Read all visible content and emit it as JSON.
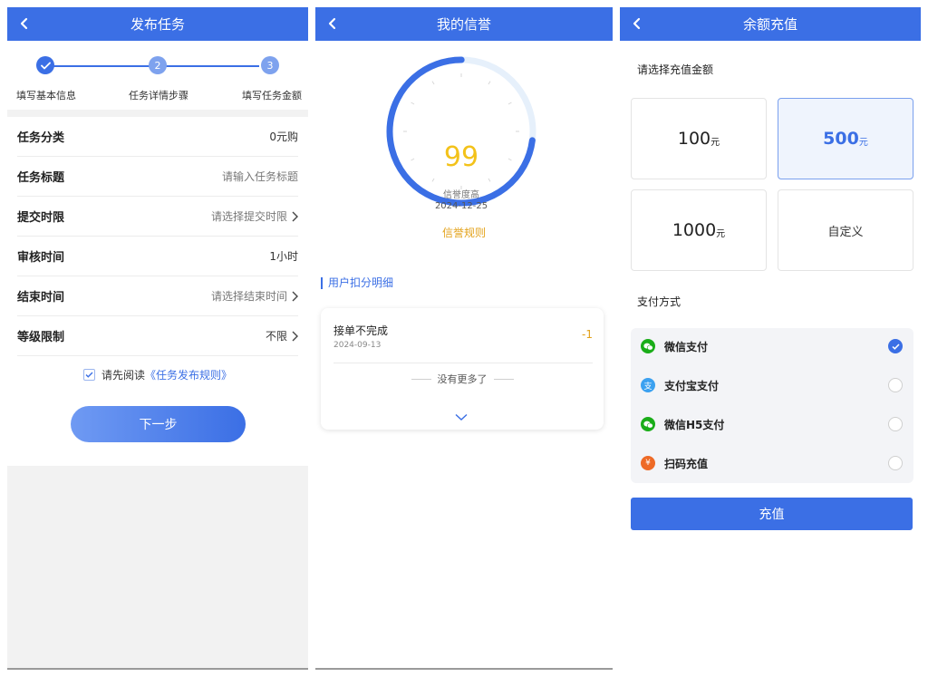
{
  "publish": {
    "title": "发布任务",
    "steps": [
      {
        "num": "",
        "label": "填写基本信息",
        "done": true
      },
      {
        "num": "2",
        "label": "任务详情步骤",
        "done": false
      },
      {
        "num": "3",
        "label": "填写任务金额",
        "done": false
      }
    ],
    "rows": [
      {
        "label": "任务分类",
        "value": "0元购",
        "placeholder": false,
        "chevron": false
      },
      {
        "label": "任务标题",
        "value": "请输入任务标题",
        "placeholder": true,
        "chevron": false
      },
      {
        "label": "提交时限",
        "value": "请选择提交时限",
        "placeholder": true,
        "chevron": true
      },
      {
        "label": "审核时间",
        "value": "1小时",
        "placeholder": false,
        "chevron": false
      },
      {
        "label": "结束时间",
        "value": "请选择结束时间",
        "placeholder": true,
        "chevron": true
      },
      {
        "label": "等级限制",
        "value": "不限",
        "placeholder": false,
        "chevron": true
      }
    ],
    "agree_prefix": "请先阅读",
    "agree_link": "《任务发布规则》",
    "agree_checked": true,
    "next_label": "下一步"
  },
  "credit": {
    "title": "我的信誉",
    "score": "99",
    "score_ratio": 0.73,
    "level": "信誉度高",
    "date": "2024-12-25",
    "rule_link": "信誉规则",
    "section_title": "用户扣分明细",
    "records": [
      {
        "name": "接单不完成",
        "date": "2024-09-13",
        "points": "-1"
      }
    ],
    "no_more": "没有更多了"
  },
  "recharge": {
    "title": "余额充值",
    "amount_label": "请选择充值金额",
    "amounts": [
      {
        "value": "100",
        "unit": "元",
        "selected": false
      },
      {
        "value": "500",
        "unit": "元",
        "selected": true
      },
      {
        "value": "1000",
        "unit": "元",
        "selected": false
      }
    ],
    "custom_label": "自定义",
    "pay_label": "支付方式",
    "methods": [
      {
        "name": "微信支付",
        "icon": "wechat-icon",
        "color": "#1aad19",
        "selected": true
      },
      {
        "name": "支付宝支付",
        "icon": "alipay-icon",
        "color": "#1677ff",
        "selected": false
      },
      {
        "name": "微信H5支付",
        "icon": "wechat-icon",
        "color": "#1aad19",
        "selected": false
      },
      {
        "name": "扫码充值",
        "icon": "yen-icon",
        "color": "#ee6a26",
        "selected": false
      }
    ],
    "submit_label": "充值"
  },
  "colors": {
    "primary": "#3b6fe5",
    "accent_yellow": "#f3c21a",
    "accent_orange": "#e3a21a"
  }
}
